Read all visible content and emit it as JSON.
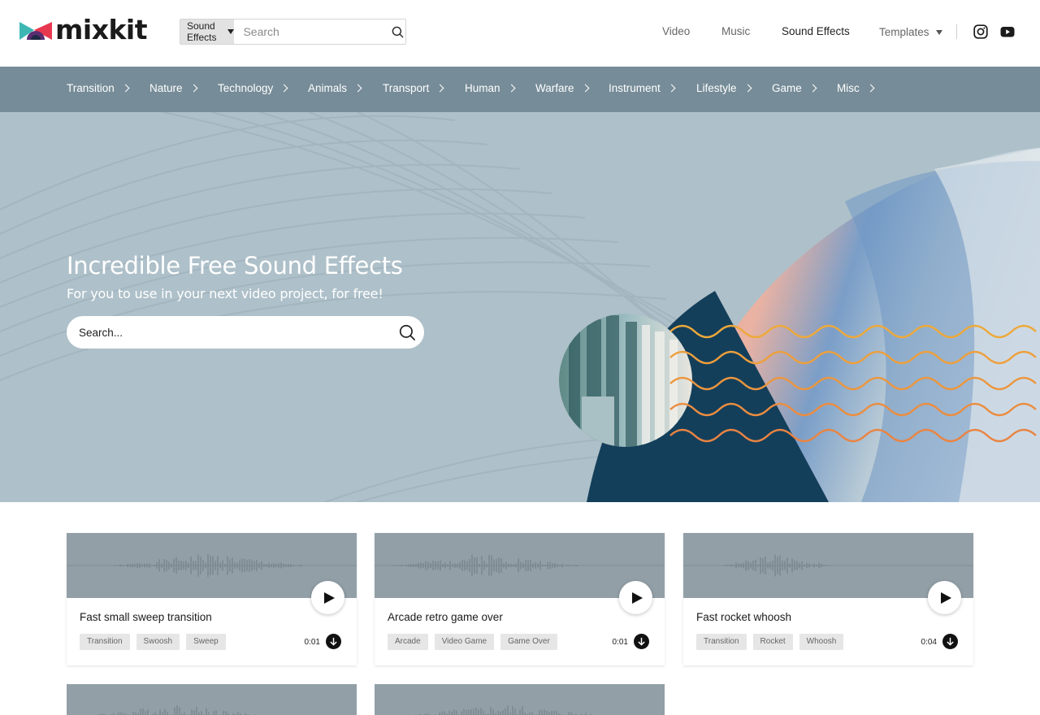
{
  "brand": {
    "name": "mixkit"
  },
  "header_search": {
    "type_label": "Sound Effects",
    "placeholder": "Search"
  },
  "top_nav": [
    {
      "label": "Video",
      "active": false
    },
    {
      "label": "Music",
      "active": false
    },
    {
      "label": "Sound Effects",
      "active": true
    },
    {
      "label": "Templates",
      "active": false,
      "has_dropdown": true
    }
  ],
  "social": [
    "instagram-icon",
    "youtube-icon"
  ],
  "categories": [
    "Transition",
    "Nature",
    "Technology",
    "Animals",
    "Transport",
    "Human",
    "Warfare",
    "Instrument",
    "Lifestyle",
    "Game",
    "Misc"
  ],
  "hero": {
    "title": "Incredible Free Sound Effects",
    "subtitle": "For you to use in your next video project, for free!",
    "search_placeholder": "Search..."
  },
  "cards": [
    {
      "title": "Fast small sweep transition",
      "tags": [
        "Transition",
        "Swoosh",
        "Sweep"
      ],
      "duration": "0:01"
    },
    {
      "title": "Arcade retro game over",
      "tags": [
        "Arcade",
        "Video Game",
        "Game Over"
      ],
      "duration": "0:01"
    },
    {
      "title": "Fast rocket whoosh",
      "tags": [
        "Transition",
        "Rocket",
        "Whoosh"
      ],
      "duration": "0:04"
    }
  ],
  "colors": {
    "category_bar": "#768c98",
    "hero_bg": "#aec0c9",
    "waveform_bg": "#929fa7",
    "hero_navy": "#143f5b",
    "wave_lines": "#f0a33a"
  }
}
